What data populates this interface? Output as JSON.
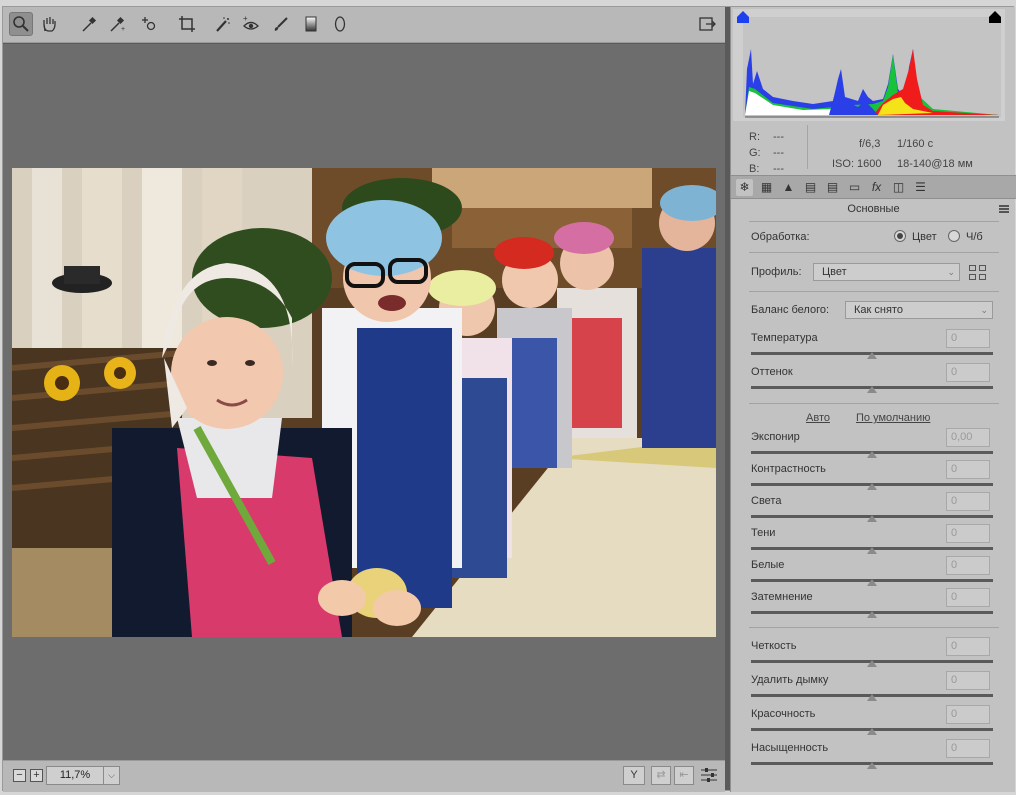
{
  "toolbar": {
    "tools": [
      "zoom-tool",
      "hand-tool",
      "white-balance-tool",
      "color-sampler-tool",
      "targeted-adjustment-tool",
      "crop-tool",
      "spot-removal-tool",
      "red-eye-tool",
      "adjustment-brush",
      "graduated-filter",
      "radial-filter"
    ],
    "export_icon": "open-image-icon"
  },
  "status": {
    "zoom_value": "11,7%",
    "minus_label": "−",
    "plus_label": "+",
    "y_label": "Y"
  },
  "exif": {
    "r_label": "R:",
    "r_value": "---",
    "g_label": "G:",
    "g_value": "---",
    "b_label": "B:",
    "b_value": "---",
    "aperture": "f/6,3",
    "shutter": "1/160 с",
    "iso": "ISO: 1600",
    "lens": "18-140@18 мм"
  },
  "panel": {
    "section_title": "Основные",
    "processing_label": "Обработка:",
    "color_option": "Цвет",
    "bw_option": "Ч/б",
    "profile_label": "Профиль:",
    "profile_value": "Цвет",
    "wb_label": "Баланс белого:",
    "wb_value": "Как снято",
    "auto_link": "Авто",
    "default_link": "По умолчанию"
  },
  "sliders_top": [
    {
      "label": "Температура",
      "value": "0"
    },
    {
      "label": "Оттенок",
      "value": "0"
    }
  ],
  "sliders_tone": [
    {
      "label": "Экспонир",
      "value": "0,00"
    },
    {
      "label": "Контрастность",
      "value": "0"
    },
    {
      "label": "Света",
      "value": "0"
    },
    {
      "label": "Тени",
      "value": "0"
    },
    {
      "label": "Белые",
      "value": "0"
    },
    {
      "label": "Затемнение",
      "value": "0"
    }
  ],
  "sliders_presence": [
    {
      "label": "Четкость",
      "value": "0"
    },
    {
      "label": "Удалить дымку",
      "value": "0"
    },
    {
      "label": "Красочность",
      "value": "0"
    },
    {
      "label": "Насыщенность",
      "value": "0"
    }
  ],
  "colors": {
    "panel_bg": "#c2c2c2",
    "canvas_bg": "#6d6d6d",
    "toolbar_bg": "#b8b8b8"
  }
}
